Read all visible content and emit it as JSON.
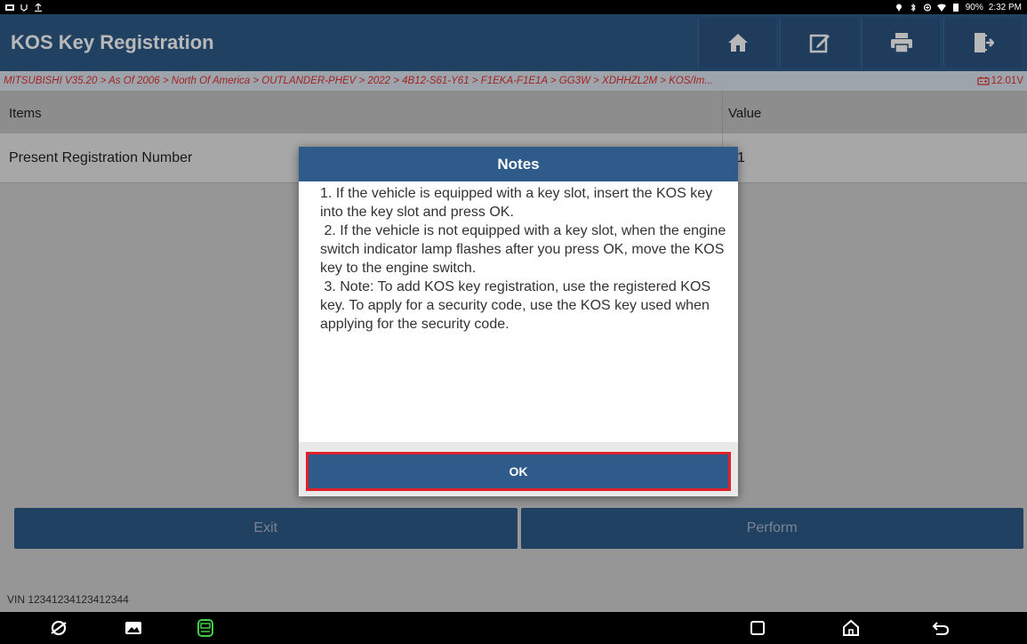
{
  "statusbar": {
    "time": "2:32 PM",
    "battery": "90%"
  },
  "header": {
    "title": "KOS Key Registration",
    "icons": [
      "home-icon",
      "edit-icon",
      "print-icon",
      "exit-icon"
    ]
  },
  "breadcrumb": {
    "path": "MITSUBISHI V35.20 > As Of 2006 > North Of America > OUTLANDER-PHEV > 2022 > 4B12-S61-Y61 > F1EKA-F1E1A > GG3W > XDHHZL2M > KOS/Im...",
    "voltage": "12.01V"
  },
  "table": {
    "headers": [
      "Items",
      "Value"
    ],
    "rows": [
      {
        "item": "Present Registration Number",
        "value": "1"
      }
    ]
  },
  "actions": {
    "exit": "Exit",
    "perform": "Perform"
  },
  "vin": "VIN 12341234123412344",
  "dialog": {
    "title": "Notes",
    "body": "1. If the vehicle is equipped with a key slot, insert the KOS key into the key slot and press OK.\n 2. If the vehicle is not equipped with a key slot, when the engine switch indicator lamp flashes after you press OK, move the KOS key to the engine switch.\n 3. Note: To add KOS key registration, use the registered KOS key. To apply for a security code, use the KOS key used when applying for the security code.",
    "ok_label": "OK"
  },
  "colors": {
    "header": "#2f5b8a",
    "breadcrumb_text": "#e23030",
    "highlight": "#e0202a"
  }
}
